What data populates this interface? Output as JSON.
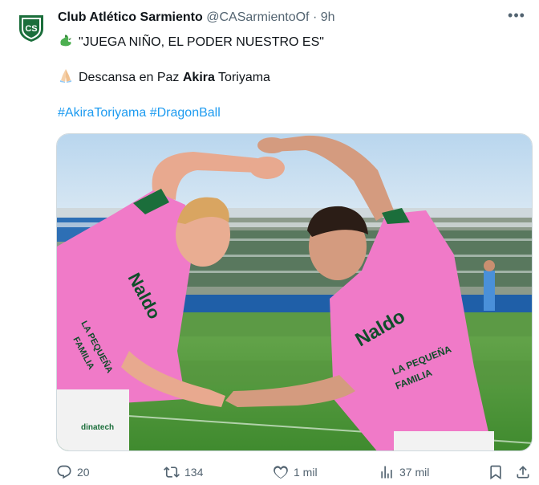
{
  "tweet": {
    "account_name": "Club Atlético Sarmiento",
    "handle": "@CASarmientoOf",
    "separator": "·",
    "time": "9h",
    "line1": "\"JUEGA NIÑO, EL PODER NUESTRO ES\"",
    "line2_prefix": "Descansa en Paz ",
    "line2_bold": "Akira",
    "line2_suffix": " Toriyama",
    "hashtags": [
      "#AkiraToriyama",
      "#DragonBall"
    ],
    "avatar_letters": "CS"
  },
  "media": {
    "jersey_brand": "Naldo",
    "sponsor_line1": "LA PEQUEÑA",
    "sponsor_line2": "FAMILIA",
    "sleeve_sponsor": "dinatech"
  },
  "actions": {
    "replies": "20",
    "reposts": "134",
    "likes": "1 mil",
    "views": "37 mil"
  },
  "icons": [
    "more-icon",
    "dragon-emoji-icon",
    "praying-hands-emoji-icon",
    "reply-icon",
    "repost-icon",
    "like-icon",
    "views-icon",
    "bookmark-icon",
    "share-icon"
  ],
  "colors": {
    "accent": "#1d9bf0",
    "secondary_text": "#536471",
    "club_green": "#1b6e3b",
    "jersey_pink": "#f07ac8"
  }
}
